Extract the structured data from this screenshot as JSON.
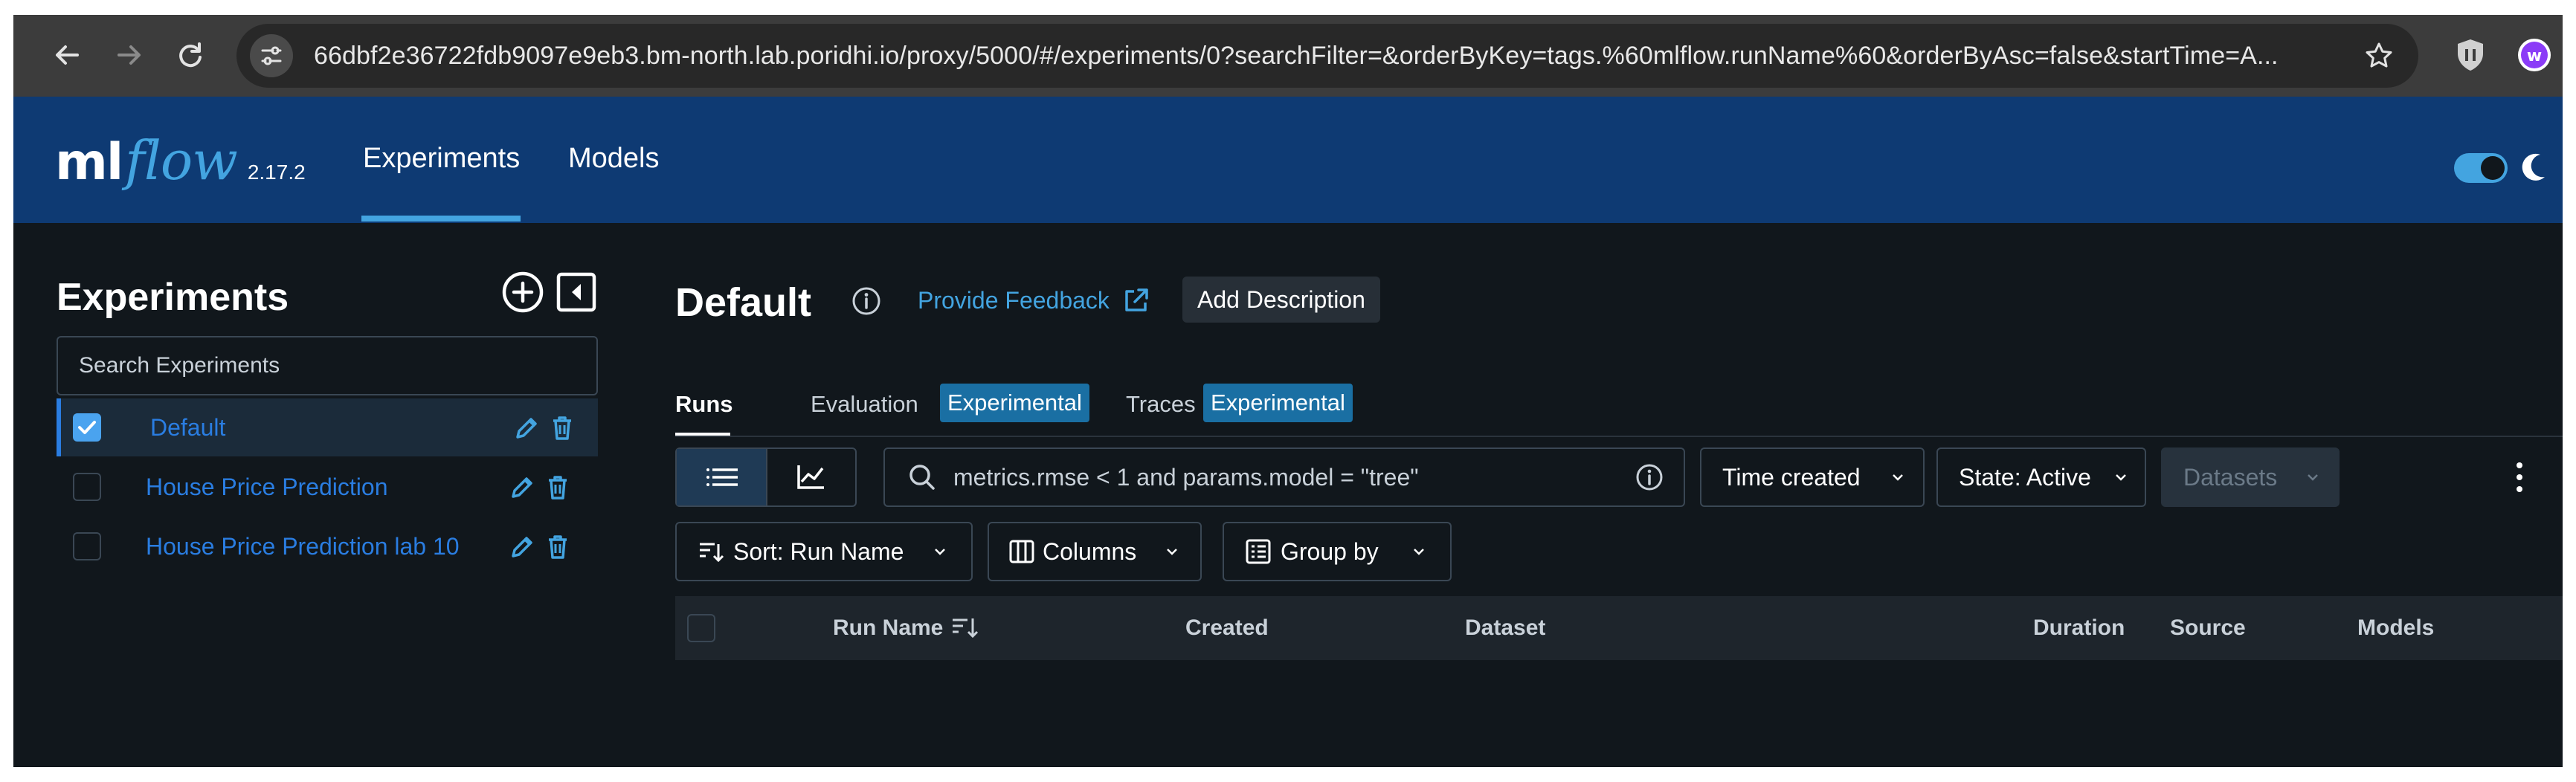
{
  "browser": {
    "url": "66dbf2e36722fdb9097e9eb3.bm-north.lab.poridhi.io/proxy/5000/#/experiments/0?searchFilter=&orderByKey=tags.%60mlflow.runName%60&orderByAsc=false&startTime=A..."
  },
  "header": {
    "logo_ml": "ml",
    "logo_flow": "flow",
    "version": "2.17.2",
    "nav": {
      "experiments": "Experiments",
      "models": "Models"
    },
    "accent_color": "#43a4e0",
    "bg_color": "#0e3a73"
  },
  "sidebar": {
    "title": "Experiments",
    "search_placeholder": "Search Experiments",
    "experiments": [
      {
        "name": "Default",
        "selected": true
      },
      {
        "name": "House Price Prediction",
        "selected": false
      },
      {
        "name": "House Price Prediction lab 10",
        "selected": false
      }
    ]
  },
  "main": {
    "title": "Default",
    "feedback_link": "Provide Feedback",
    "add_description": "Add Description",
    "tabs": [
      {
        "label": "Runs",
        "active": true
      },
      {
        "label": "Evaluation",
        "badge": "Experimental"
      },
      {
        "label": "Traces",
        "badge": "Experimental"
      }
    ],
    "search_runs_placeholder": "metrics.rmse < 1 and params.model = \"tree\"",
    "filters": {
      "time_created": "Time created",
      "state": "State: Active",
      "datasets": "Datasets"
    },
    "actions": {
      "sort": "Sort: Run Name",
      "columns": "Columns",
      "group_by": "Group by"
    },
    "table_columns": [
      "Run Name",
      "Created",
      "Dataset",
      "Duration",
      "Source",
      "Models"
    ]
  }
}
